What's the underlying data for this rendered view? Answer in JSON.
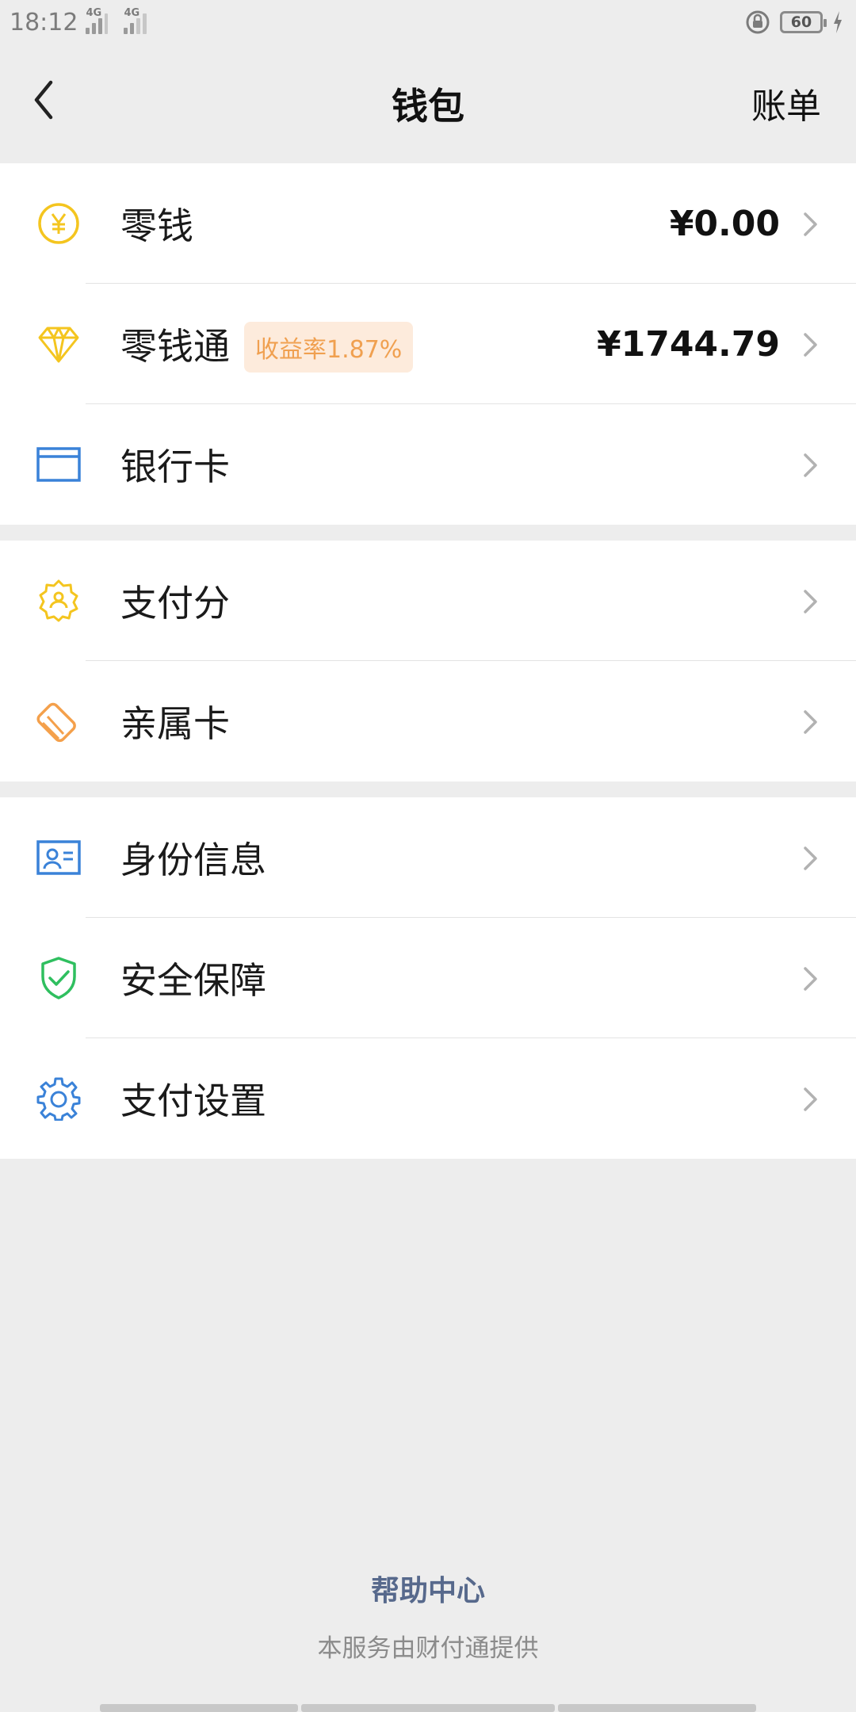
{
  "status_bar": {
    "time": "18:12",
    "signal1_tag": "4G",
    "signal2_tag": "4G",
    "battery": "60"
  },
  "nav": {
    "title": "钱包",
    "right": "账单"
  },
  "groups": [
    {
      "rows": [
        {
          "label": "零钱",
          "amount": "¥0.00"
        },
        {
          "label": "零钱通",
          "badge": "收益率1.87%",
          "amount": "¥1744.79"
        },
        {
          "label": "银行卡"
        }
      ]
    },
    {
      "rows": [
        {
          "label": "支付分"
        },
        {
          "label": "亲属卡"
        }
      ]
    },
    {
      "rows": [
        {
          "label": "身份信息"
        },
        {
          "label": "安全保障"
        },
        {
          "label": "支付设置"
        }
      ]
    }
  ],
  "footer": {
    "help": "帮助中心",
    "provider": "本服务由财付通提供"
  },
  "colors": {
    "yellow": "#f4c51f",
    "orange": "#f4a04b",
    "blue": "#3a82d8",
    "green": "#2fbf5f",
    "link": "#57698c"
  }
}
